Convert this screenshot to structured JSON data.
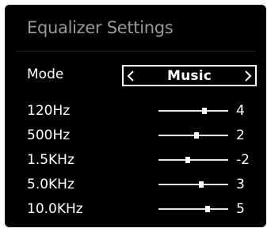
{
  "window": {
    "title": "Equalizer Settings"
  },
  "mode": {
    "label": "Mode",
    "value": "Music",
    "prev_icon": "chevron-left-icon",
    "next_icon": "chevron-right-icon"
  },
  "bands": [
    {
      "label": "120Hz",
      "value": "4",
      "level": 0.66
    },
    {
      "label": "500Hz",
      "value": "2",
      "level": 0.55
    },
    {
      "label": "1.5KHz",
      "value": "-2",
      "level": 0.42
    },
    {
      "label": "5.0KHz",
      "value": "3",
      "level": 0.61
    },
    {
      "label": "10.0KHz",
      "value": "5",
      "level": 0.7
    }
  ],
  "colors": {
    "background": "#000000",
    "title": "#9a9a9a",
    "text": "#ffffff",
    "slider": "#e6e6e6"
  }
}
